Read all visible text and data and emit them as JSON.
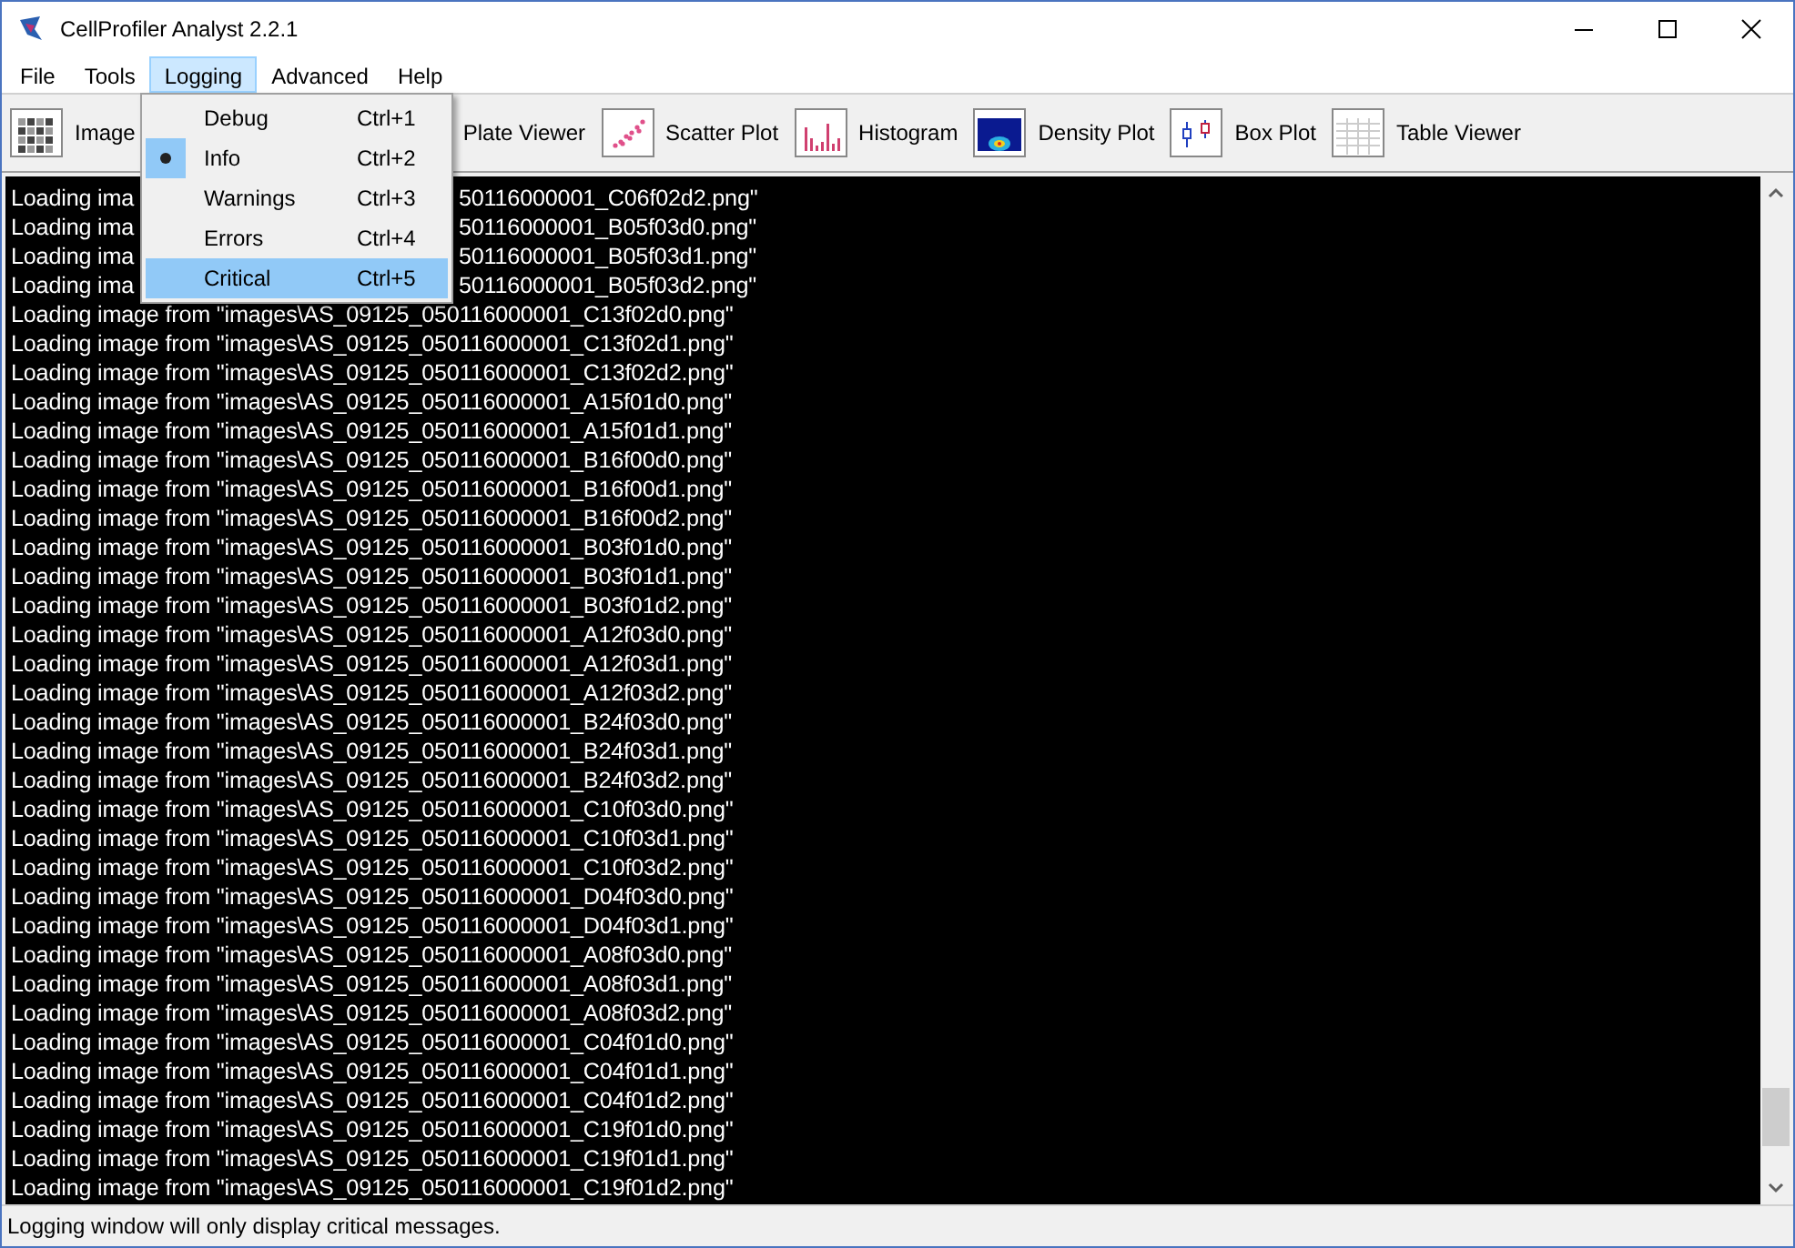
{
  "window": {
    "title": "CellProfiler Analyst 2.2.1"
  },
  "menu_bar": [
    {
      "label": "File",
      "selected": false
    },
    {
      "label": "Tools",
      "selected": false
    },
    {
      "label": "Logging",
      "selected": true
    },
    {
      "label": "Advanced",
      "selected": false
    },
    {
      "label": "Help",
      "selected": false
    }
  ],
  "logging_menu": [
    {
      "label": "Debug",
      "shortcut": "Ctrl+1",
      "selected": false,
      "highlighted": false
    },
    {
      "label": "Info",
      "shortcut": "Ctrl+2",
      "selected": true,
      "highlighted": false
    },
    {
      "label": "Warnings",
      "shortcut": "Ctrl+3",
      "selected": false,
      "highlighted": false
    },
    {
      "label": "Errors",
      "shortcut": "Ctrl+4",
      "selected": false,
      "highlighted": false
    },
    {
      "label": "Critical",
      "shortcut": "Ctrl+5",
      "selected": false,
      "highlighted": true
    }
  ],
  "toolbar": [
    {
      "label": "Image"
    },
    {
      "label": "Plate Viewer"
    },
    {
      "label": "Scatter Plot"
    },
    {
      "label": "Histogram"
    },
    {
      "label": "Density Plot"
    },
    {
      "label": "Box Plot"
    },
    {
      "label": "Table Viewer"
    }
  ],
  "log_lines": [
    {
      "text": "Loading ima",
      "tail": "50116000001_C06f02d2.png\""
    },
    {
      "text": "Loading ima",
      "tail": "50116000001_B05f03d0.png\""
    },
    {
      "text": "Loading ima",
      "tail": "50116000001_B05f03d1.png\""
    },
    {
      "text": "Loading ima",
      "tail": "50116000001_B05f03d2.png\""
    },
    {
      "text": "Loading image from \"images\\AS_09125_050116000001_C13f02d0.png\""
    },
    {
      "text": "Loading image from \"images\\AS_09125_050116000001_C13f02d1.png\""
    },
    {
      "text": "Loading image from \"images\\AS_09125_050116000001_C13f02d2.png\""
    },
    {
      "text": "Loading image from \"images\\AS_09125_050116000001_A15f01d0.png\""
    },
    {
      "text": "Loading image from \"images\\AS_09125_050116000001_A15f01d1.png\""
    },
    {
      "text": "Loading image from \"images\\AS_09125_050116000001_B16f00d0.png\""
    },
    {
      "text": "Loading image from \"images\\AS_09125_050116000001_B16f00d1.png\""
    },
    {
      "text": "Loading image from \"images\\AS_09125_050116000001_B16f00d2.png\""
    },
    {
      "text": "Loading image from \"images\\AS_09125_050116000001_B03f01d0.png\""
    },
    {
      "text": "Loading image from \"images\\AS_09125_050116000001_B03f01d1.png\""
    },
    {
      "text": "Loading image from \"images\\AS_09125_050116000001_B03f01d2.png\""
    },
    {
      "text": "Loading image from \"images\\AS_09125_050116000001_A12f03d0.png\""
    },
    {
      "text": "Loading image from \"images\\AS_09125_050116000001_A12f03d1.png\""
    },
    {
      "text": "Loading image from \"images\\AS_09125_050116000001_A12f03d2.png\""
    },
    {
      "text": "Loading image from \"images\\AS_09125_050116000001_B24f03d0.png\""
    },
    {
      "text": "Loading image from \"images\\AS_09125_050116000001_B24f03d1.png\""
    },
    {
      "text": "Loading image from \"images\\AS_09125_050116000001_B24f03d2.png\""
    },
    {
      "text": "Loading image from \"images\\AS_09125_050116000001_C10f03d0.png\""
    },
    {
      "text": "Loading image from \"images\\AS_09125_050116000001_C10f03d1.png\""
    },
    {
      "text": "Loading image from \"images\\AS_09125_050116000001_C10f03d2.png\""
    },
    {
      "text": "Loading image from \"images\\AS_09125_050116000001_D04f03d0.png\""
    },
    {
      "text": "Loading image from \"images\\AS_09125_050116000001_D04f03d1.png\""
    },
    {
      "text": "Loading image from \"images\\AS_09125_050116000001_A08f03d0.png\""
    },
    {
      "text": "Loading image from \"images\\AS_09125_050116000001_A08f03d1.png\""
    },
    {
      "text": "Loading image from \"images\\AS_09125_050116000001_A08f03d2.png\""
    },
    {
      "text": "Loading image from \"images\\AS_09125_050116000001_C04f01d0.png\""
    },
    {
      "text": "Loading image from \"images\\AS_09125_050116000001_C04f01d1.png\""
    },
    {
      "text": "Loading image from \"images\\AS_09125_050116000001_C04f01d2.png\""
    },
    {
      "text": "Loading image from \"images\\AS_09125_050116000001_C19f01d0.png\""
    },
    {
      "text": "Loading image from \"images\\AS_09125_050116000001_C19f01d1.png\""
    },
    {
      "text": "Loading image from \"images\\AS_09125_050116000001_C19f01d2.png\""
    }
  ],
  "status_bar": "Logging window will only display critical messages."
}
